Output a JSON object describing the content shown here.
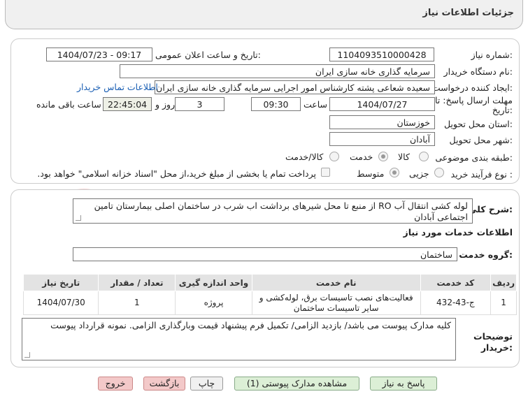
{
  "header": {
    "title": "جزئیات اطلاعات نیاز"
  },
  "form": {
    "need_number_label": "شماره نیاز:",
    "need_number": "1104093510000428",
    "announce_label": "تاریخ و ساعت اعلان عمومی:",
    "announce_value": "1404/07/23 - 09:17",
    "buyer_org_label": "نام دستگاه خریدار:",
    "buyer_org": "سرمایه گذاری خانه سازی ایران",
    "creator_label": "ایجاد کننده درخواست:",
    "creator": "سعیده شعاعی پشته کارشناس امور اجرایی سرمایه گذاری خانه سازی ایران",
    "contact_link": "اطلاعات تماس خریدار",
    "deadline_label_1": "مهلت ارسال پاسخ: تا",
    "deadline_label_2": "تاریخ:",
    "deadline_date": "1404/07/27",
    "time_label": "ساعت",
    "deadline_time": "09:30",
    "days_value": "3",
    "days_label": "روز و",
    "remaining_time": "22:45:04",
    "remaining_label": "ساعت باقی مانده",
    "province_label": "استان محل تحویل:",
    "province": "خوزستان",
    "city_label": "شهر محل تحویل:",
    "city": "آبادان",
    "category_label": "طبقه بندی موضوعی:",
    "category_options": [
      "کالا",
      "خدمت",
      "کالا/خدمت"
    ],
    "category_selected": "خدمت",
    "process_label": "نوع فرآیند خرید :",
    "process_options": [
      "جزیی",
      "متوسط"
    ],
    "process_selected": "متوسط",
    "payment_note": "پرداخت تمام یا بخشی از مبلغ خرید،از محل \"اسناد خزانه اسلامی\" خواهد بود."
  },
  "details": {
    "summary_label": "شرح کلی نیاز:",
    "summary": "لوله کشی انتقال آب RO از منبع تا محل شیرهای برداشت اب شرب در ساختمان اصلی بیمارستان تامین اجتماعی آبادان",
    "services_title": "اطلاعات خدمات مورد نیاز",
    "service_group_label": "گروه خدمت:",
    "service_group": "ساختمان",
    "table": {
      "headers": [
        "ردیف",
        "کد خدمت",
        "نام خدمت",
        "واحد اندازه گیری",
        "تعداد / مقدار",
        "تاریخ نیاز"
      ],
      "rows": [
        [
          "1",
          "ج-43-432",
          "فعالیت‌های نصب تاسیسات برق، لوله‌کشی و سایر تاسیسات ساختمان",
          "پروژه",
          "1",
          "1404/07/30"
        ]
      ]
    },
    "buyer_notes_label_1": "توضیحات",
    "buyer_notes_label_2": "خریدار:",
    "buyer_notes": "کلیه مدارک پیوست می باشد/ بازدید الزامی/ تکمیل فرم پیشنهاد قیمت وبارگذاری الزامی. نمونه قرارداد پیوست"
  },
  "buttons": {
    "reply": "پاسخ به نیاز",
    "attachments": "مشاهده مدارک پیوستی (1)",
    "print": "چاپ",
    "back": "بازگشت",
    "exit": "خروج"
  }
}
